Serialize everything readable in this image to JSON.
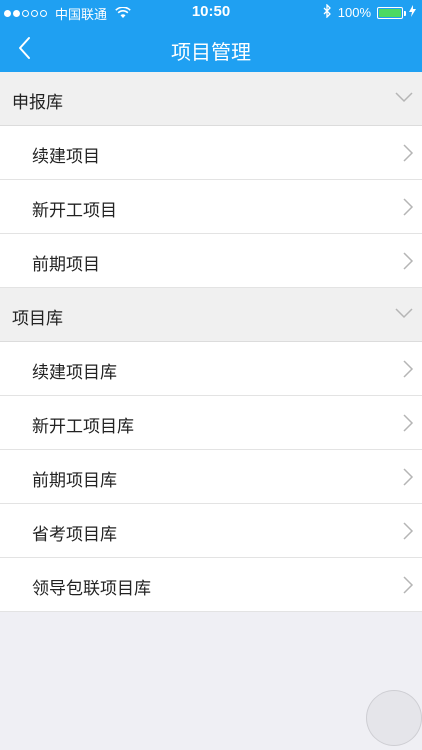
{
  "status_bar": {
    "carrier": "中国联通",
    "time": "10:50",
    "battery_percent": "100%",
    "battery_level": 1.0,
    "signal_bars_filled": 2,
    "signal_bars_total": 5
  },
  "nav": {
    "title": "项目管理",
    "back_icon": "chevron-left-icon"
  },
  "sections": [
    {
      "title": "申报库",
      "items": [
        "续建项目",
        "新开工项目",
        "前期项目"
      ]
    },
    {
      "title": "项目库",
      "items": [
        "续建项目库",
        "新开工项目库",
        "前期项目库",
        "省考项目库",
        "领导包联项目库"
      ]
    }
  ],
  "colors": {
    "nav_blue": "#1fa0f2",
    "background": "#efeff4",
    "section_bg": "#f0f0f0",
    "chevron": "#b5b5b5"
  }
}
